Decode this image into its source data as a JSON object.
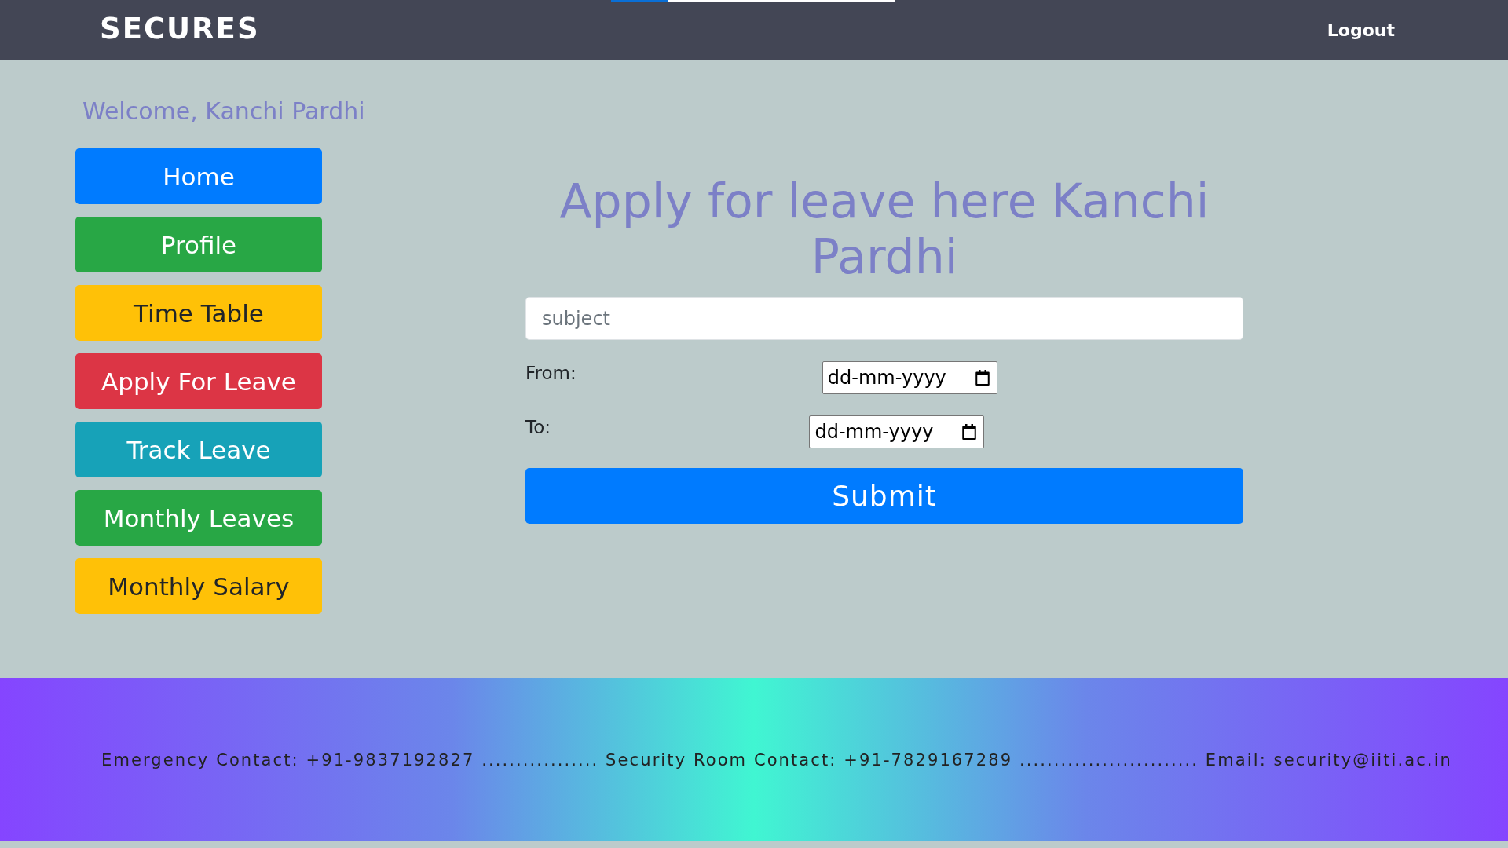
{
  "top_bar": {
    "brand": "SECURES",
    "logout": "Logout",
    "load_bar": {
      "level": 0.2
    }
  },
  "sidebar": {
    "welcome": "Welcome, Kanchi Pardhi",
    "items": [
      {
        "label": "Home",
        "color": "#007bff"
      },
      {
        "label": "Profile",
        "color": "#28a745"
      },
      {
        "label": "Time Table",
        "color": "#ffc107"
      },
      {
        "label": "Apply For Leave",
        "color": "#dc3545"
      },
      {
        "label": "Track Leave",
        "color": "#17a2b8"
      },
      {
        "label": "Monthly Leaves",
        "color": "#28a745"
      },
      {
        "label": "Monthly Salary",
        "color": "#ffc107"
      }
    ]
  },
  "form": {
    "title": "Apply for leave here Kanchi Pardhi",
    "subject": {
      "placeholder": "subject"
    },
    "dates": [
      {
        "label": "From:",
        "placeholder": "dd-mm-yyyy"
      },
      {
        "label": "To:",
        "placeholder": "dd-mm-yyyy"
      }
    ],
    "submit": "Submit"
  },
  "footer": {
    "text": "Emergency Contact: +91-9837192827 ................. Security Room Contact: +91-7829167289 .......................... Email: security@iiti.ac.in"
  }
}
